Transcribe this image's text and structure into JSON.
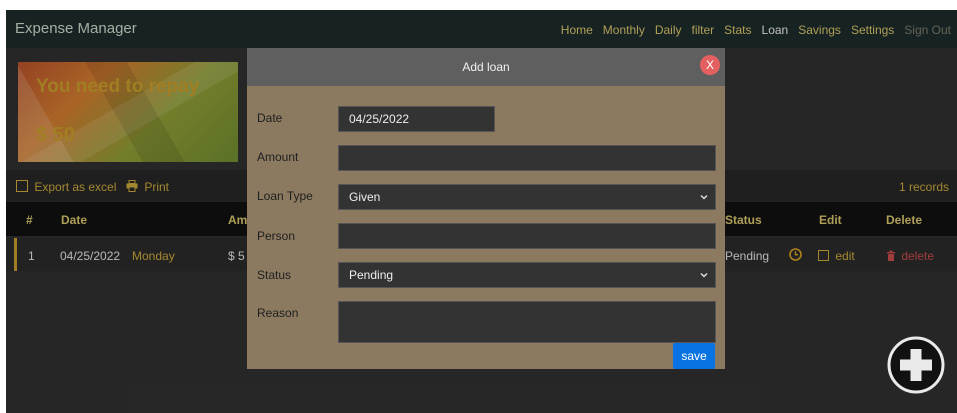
{
  "app": {
    "title": "Expense Manager"
  },
  "nav": {
    "items": [
      {
        "label": "Home"
      },
      {
        "label": "Monthly"
      },
      {
        "label": "Daily"
      },
      {
        "label": "filter"
      },
      {
        "label": "Stats"
      },
      {
        "label": "Loan"
      },
      {
        "label": "Savings"
      },
      {
        "label": "Settings"
      },
      {
        "label": "Sign Out"
      }
    ]
  },
  "banner": {
    "title": "You need to repay",
    "amount": "$ 50"
  },
  "toolbar": {
    "export_label": "Export as excel",
    "print_label": "Print",
    "records": "1 records"
  },
  "table": {
    "headers": {
      "index": "#",
      "date": "Date",
      "amount": "Am",
      "status": "Status",
      "edit": "Edit",
      "delete": "Delete"
    },
    "rows": [
      {
        "index": "1",
        "date": "04/25/2022",
        "day": "Monday",
        "amount": "$ 5",
        "status": "Pending",
        "edit": "edit",
        "delete": "delete"
      }
    ]
  },
  "modal": {
    "title": "Add loan",
    "close": "X",
    "fields": {
      "date": {
        "label": "Date",
        "value": "04/25/2022"
      },
      "amount": {
        "label": "Amount",
        "value": ""
      },
      "loan_type": {
        "label": "Loan Type",
        "value": "Given"
      },
      "person": {
        "label": "Person",
        "value": ""
      },
      "status": {
        "label": "Status",
        "value": "Pending"
      },
      "reason": {
        "label": "Reason",
        "value": ""
      }
    },
    "save_label": "save"
  },
  "colors": {
    "accent_gold": "#d6c36a",
    "primary_blue": "#0a73e4",
    "danger_red": "#e46060"
  },
  "icons": {
    "export": "excel-file-icon",
    "print": "print-icon",
    "status": "clock-icon",
    "edit": "edit-icon",
    "delete": "trash-icon",
    "add": "plus-circle-icon"
  }
}
